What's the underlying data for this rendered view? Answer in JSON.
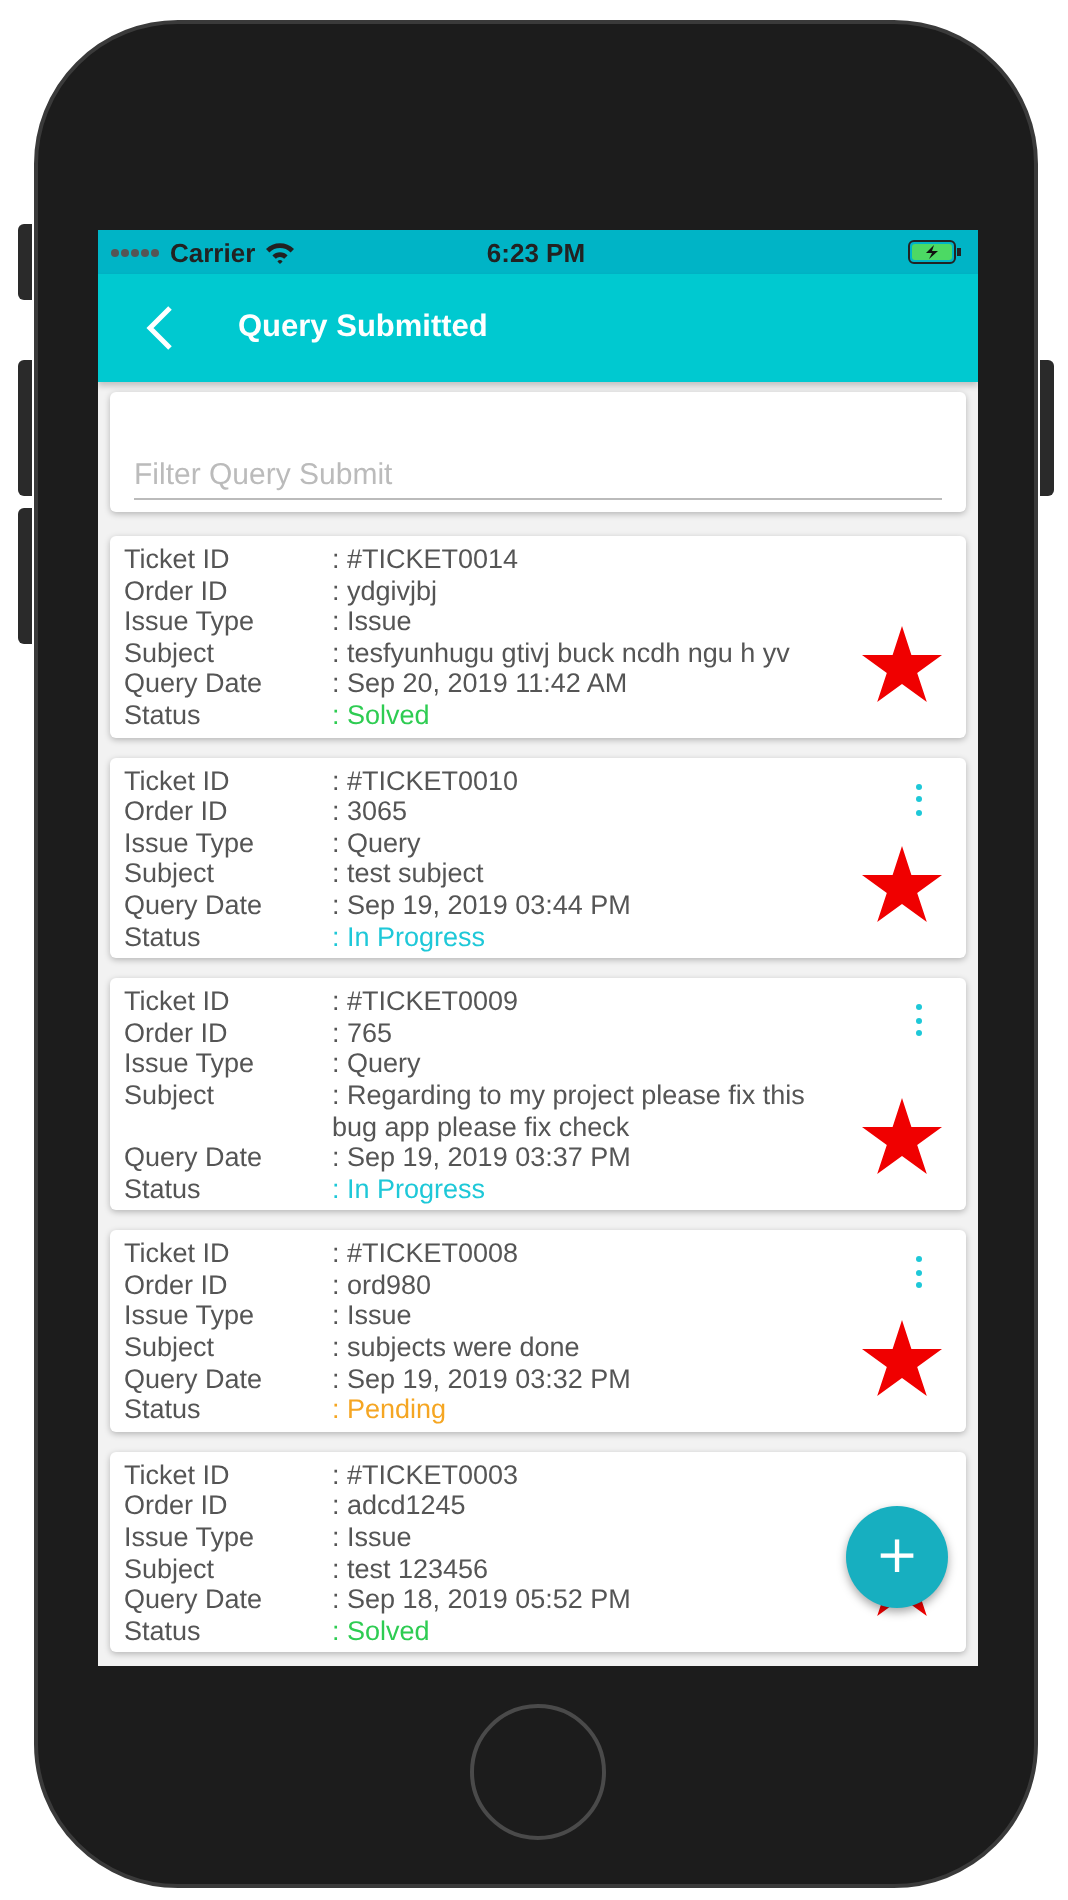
{
  "status_bar": {
    "carrier": "Carrier",
    "time": "6:23 PM"
  },
  "header": {
    "title": "Query Submitted"
  },
  "search": {
    "placeholder": "Filter Query Submit"
  },
  "tickets": [
    {
      "has_menu": false,
      "fields": [
        {
          "label": "Ticket ID",
          "value": ": #TICKET0014"
        },
        {
          "label": "Order ID",
          "value": ": ydgivjbj"
        },
        {
          "label": "Issue Type",
          "value": ": Issue"
        },
        {
          "label": "Subject",
          "value": ": tesfyunhugu gtivj buck ncdh ngu h yv"
        },
        {
          "label": "Query Date",
          "value": ": Sep 20, 2019 11:42 AM"
        }
      ],
      "status": {
        "label": "Status",
        "value": ": Solved",
        "color": "#2ecc52"
      }
    },
    {
      "has_menu": true,
      "fields": [
        {
          "label": "Ticket ID",
          "value": ": #TICKET0010"
        },
        {
          "label": "Order ID",
          "value": ": 3065"
        },
        {
          "label": "Issue Type",
          "value": ": Query"
        },
        {
          "label": "Subject",
          "value": ": test subject"
        },
        {
          "label": "Query Date",
          "value": ": Sep 19, 2019 03:44 PM"
        }
      ],
      "status": {
        "label": "Status",
        "value": ": In Progress",
        "color": "#1ec8d8"
      }
    },
    {
      "has_menu": true,
      "fields": [
        {
          "label": "Ticket ID",
          "value": ": #TICKET0009"
        },
        {
          "label": "Order ID",
          "value": ": 765"
        },
        {
          "label": "Issue Type",
          "value": ": Query"
        },
        {
          "label": "Subject",
          "value": ": Regarding to my project please fix this bug app please fix check"
        },
        {
          "label": "Query Date",
          "value": ": Sep 19, 2019 03:37 PM"
        }
      ],
      "status": {
        "label": "Status",
        "value": ": In Progress",
        "color": "#1ec8d8"
      }
    },
    {
      "has_menu": true,
      "fields": [
        {
          "label": "Ticket ID",
          "value": ": #TICKET0008"
        },
        {
          "label": "Order ID",
          "value": ": ord980"
        },
        {
          "label": "Issue Type",
          "value": ": Issue"
        },
        {
          "label": "Subject",
          "value": ": subjects were done"
        },
        {
          "label": "Query Date",
          "value": ": Sep 19, 2019 03:32 PM"
        }
      ],
      "status": {
        "label": "Status",
        "value": ": Pending",
        "color": "#f5a623"
      }
    },
    {
      "has_menu": false,
      "fields": [
        {
          "label": "Ticket ID",
          "value": ": #TICKET0003"
        },
        {
          "label": "Order ID",
          "value": ": adcd1245"
        },
        {
          "label": "Issue Type",
          "value": ": Issue"
        },
        {
          "label": "Subject",
          "value": ": test 123456"
        },
        {
          "label": "Query Date",
          "value": ": Sep 18, 2019 05:52 PM"
        }
      ],
      "status": {
        "label": "Status",
        "value": ": Solved",
        "color": "#2ecc52"
      }
    }
  ],
  "fab": {
    "label": "+"
  }
}
